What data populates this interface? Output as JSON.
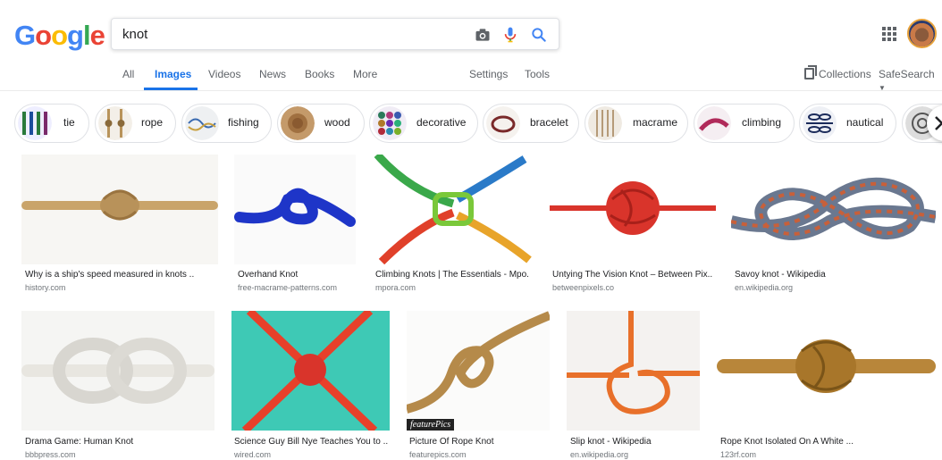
{
  "logo": {
    "letters": [
      "G",
      "o",
      "o",
      "g",
      "l",
      "e"
    ],
    "colors": [
      "#4285F4",
      "#EA4335",
      "#FBBC05",
      "#4285F4",
      "#34A853",
      "#EA4335"
    ]
  },
  "search": {
    "value": "knot",
    "icons": [
      "camera-icon",
      "microphone-icon",
      "search-icon"
    ]
  },
  "tabs": [
    {
      "label": "All"
    },
    {
      "label": "Images",
      "active": true
    },
    {
      "label": "Videos"
    },
    {
      "label": "News"
    },
    {
      "label": "Books"
    },
    {
      "label": "More"
    }
  ],
  "tools": {
    "settings": "Settings",
    "tools": "Tools"
  },
  "right": {
    "collections": "Collections",
    "safesearch": "SafeSearch"
  },
  "chips": [
    {
      "label": "tie"
    },
    {
      "label": "rope"
    },
    {
      "label": "fishing"
    },
    {
      "label": "wood"
    },
    {
      "label": "decorative"
    },
    {
      "label": "bracelet"
    },
    {
      "label": "macrame"
    },
    {
      "label": "climbing"
    },
    {
      "label": "nautical"
    }
  ],
  "results": [
    {
      "title": "Why is a ship's speed measured in knots ...",
      "source": "history.com"
    },
    {
      "title": "Overhand Knot",
      "source": "free-macrame-patterns.com"
    },
    {
      "title": "Climbing Knots | The Essentials - Mpo...",
      "source": "mpora.com"
    },
    {
      "title": "Untying The Vision Knot – Between Pix...",
      "source": "betweenpixels.co"
    },
    {
      "title": "Savoy knot - Wikipedia",
      "source": "en.wikipedia.org"
    },
    {
      "title": "Drama Game: Human Knot",
      "source": "bbbpress.com"
    },
    {
      "title": "Science Guy Bill Nye Teaches You to ...",
      "source": "wired.com"
    },
    {
      "title": "Picture Of Rope Knot",
      "source": "featurepics.com",
      "watermark": "featurePics"
    },
    {
      "title": "Slip knot - Wikipedia",
      "source": "en.wikipedia.org"
    },
    {
      "title": "Rope Knot Isolated On A White ...",
      "source": "123rf.com"
    }
  ],
  "colors": {
    "accent": "#1a73e8",
    "rope_tan": "#c9a46a",
    "rope_blue": "#1e35c8",
    "rope_red": "#d9342b",
    "teal_bg": "#3ec9b5"
  }
}
